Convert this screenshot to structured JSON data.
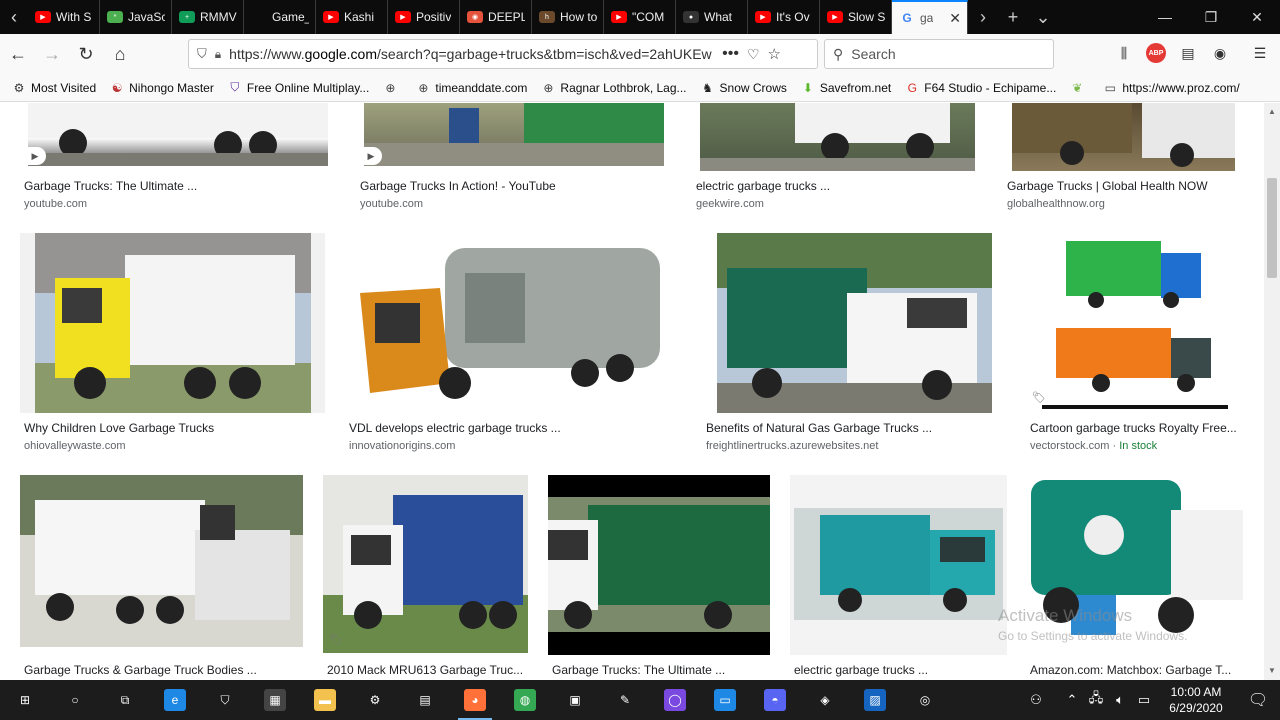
{
  "browser": {
    "tabs": [
      {
        "title": "With S",
        "icon": "youtube-icon",
        "color": "#ff0000"
      },
      {
        "title": "JavaSc",
        "icon": "css-tricks-icon",
        "color": "#4caf50"
      },
      {
        "title": "RMMV",
        "icon": "sheets-icon",
        "color": "#0f9d58"
      },
      {
        "title": "Game_Ma",
        "icon": "blank-icon",
        "color": "#444444"
      },
      {
        "title": "Kashi",
        "icon": "youtube-icon",
        "color": "#ff0000"
      },
      {
        "title": "Positiv",
        "icon": "youtube-icon",
        "color": "#ff0000"
      },
      {
        "title": "DEEPL",
        "icon": "deepl-icon",
        "color": "#e6533c"
      },
      {
        "title": "How to",
        "icon": "bookmark-icon",
        "color": "#6b4a2b"
      },
      {
        "title": "\"COM",
        "icon": "youtube-icon",
        "color": "#ff0000"
      },
      {
        "title": "What",
        "icon": "github-icon",
        "color": "#333333"
      },
      {
        "title": "It's Ov",
        "icon": "youtube-icon",
        "color": "#ff0000"
      },
      {
        "title": "Slow S",
        "icon": "youtube-icon",
        "color": "#ff0000"
      },
      {
        "title": "ga",
        "icon": "google-icon",
        "color": "#4285f4",
        "active": true
      }
    ],
    "url_prefix": "https://www.",
    "url_domain": "google.com",
    "url_rest": "/search?q=garbage+trucks&tbm=isch&ved=2ahUKEw",
    "search_placeholder": "Search",
    "abp_label": "ABP",
    "window_controls": {
      "minimize": "—",
      "restore": "❐",
      "close": "✕"
    }
  },
  "bookmarks": [
    {
      "label": "Most Visited",
      "icon": "gear-icon"
    },
    {
      "label": "Nihongo Master",
      "icon": "nihongo-icon"
    },
    {
      "label": "Free Online Multiplay...",
      "icon": "shield-icon"
    },
    {
      "label": "",
      "icon": "globe-icon"
    },
    {
      "label": "timeanddate.com",
      "icon": "globe-icon"
    },
    {
      "label": "Ragnar Lothbrok, Lag...",
      "icon": "globe-icon"
    },
    {
      "label": "Snow Crows",
      "icon": "crow-icon"
    },
    {
      "label": "Savefrom.net",
      "icon": "download-icon"
    },
    {
      "label": "F64 Studio - Echipame...",
      "icon": "google-icon"
    },
    {
      "label": "",
      "icon": "leaf-icon"
    },
    {
      "label": "https://www.proz.com/",
      "icon": "page-icon"
    }
  ],
  "results": [
    {
      "title": "Garbage Trucks: The Ultimate ...",
      "source": "youtube.com",
      "stock": ""
    },
    {
      "title": "Garbage Trucks In Action! - YouTube",
      "source": "youtube.com",
      "stock": ""
    },
    {
      "title": "electric garbage trucks ...",
      "source": "geekwire.com",
      "stock": ""
    },
    {
      "title": "Garbage Trucks | Global Health NOW",
      "source": "globalhealthnow.org",
      "stock": ""
    },
    {
      "title": "Why Children Love Garbage Trucks",
      "source": "ohiovalleywaste.com",
      "stock": ""
    },
    {
      "title": "VDL develops electric garbage trucks ...",
      "source": "innovationorigins.com",
      "stock": ""
    },
    {
      "title": "Benefits of Natural Gas Garbage Trucks ...",
      "source": "freightlinertrucks.azurewebsites.net",
      "stock": ""
    },
    {
      "title": "Cartoon garbage trucks Royalty Free...",
      "source": "vectorstock.com · ",
      "stock": "In stock"
    },
    {
      "title": "Garbage Trucks & Garbage Truck Bodies ...",
      "source": "",
      "stock": ""
    },
    {
      "title": "2010 Mack MRU613 Garbage Truc...",
      "source": "",
      "stock": ""
    },
    {
      "title": "Garbage Trucks: The Ultimate ...",
      "source": "",
      "stock": ""
    },
    {
      "title": "electric garbage trucks ...",
      "source": "",
      "stock": ""
    },
    {
      "title": "Amazon.com: Matchbox: Garbage T...",
      "source": "",
      "stock": ""
    }
  ],
  "watermark": {
    "line1": "Activate Windows",
    "line2": "Go to Settings to activate Windows."
  },
  "taskbar": {
    "time": "10:00 AM",
    "date": "6/29/2020",
    "apps": [
      {
        "name": "start",
        "icon": "windows-icon"
      },
      {
        "name": "search",
        "icon": "cortana-icon"
      },
      {
        "name": "taskview",
        "icon": "task-view-icon"
      },
      {
        "name": "edge",
        "icon": "edge-icon"
      },
      {
        "name": "security",
        "icon": "shield-icon"
      },
      {
        "name": "calculator",
        "icon": "calculator-icon"
      },
      {
        "name": "explorer",
        "icon": "folder-icon"
      },
      {
        "name": "settings",
        "icon": "gear-icon"
      },
      {
        "name": "files",
        "icon": "file-icon"
      },
      {
        "name": "firefox",
        "icon": "firefox-icon"
      },
      {
        "name": "chrome",
        "icon": "chrome-icon"
      },
      {
        "name": "calendar",
        "icon": "calendar-icon"
      },
      {
        "name": "paint",
        "icon": "paint-icon"
      },
      {
        "name": "cortana-app",
        "icon": "circle-icon"
      },
      {
        "name": "remote",
        "icon": "monitor-icon"
      },
      {
        "name": "discord",
        "icon": "discord-icon"
      },
      {
        "name": "app2",
        "icon": "app-icon"
      },
      {
        "name": "photos",
        "icon": "photo-icon"
      },
      {
        "name": "obs",
        "icon": "obs-icon"
      }
    ]
  },
  "colors": {
    "accent": "#0a84ff",
    "tray_green": "#188038"
  }
}
